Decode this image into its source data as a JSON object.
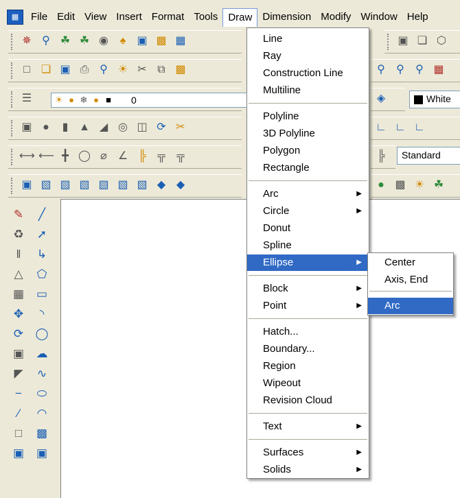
{
  "menubar": {
    "items": [
      "File",
      "Edit",
      "View",
      "Insert",
      "Format",
      "Tools",
      "Draw",
      "Dimension",
      "Modify",
      "Window",
      "Help"
    ],
    "open_item": "Draw"
  },
  "toolbars": {
    "layer_value": "0",
    "color_value": "White",
    "dimstyle_value": "Standard"
  },
  "draw_menu": {
    "groups": [
      [
        {
          "label": "Line"
        },
        {
          "label": "Ray"
        },
        {
          "label": "Construction Line"
        },
        {
          "label": "Multiline"
        }
      ],
      [
        {
          "label": "Polyline"
        },
        {
          "label": "3D Polyline"
        },
        {
          "label": "Polygon"
        },
        {
          "label": "Rectangle"
        }
      ],
      [
        {
          "label": "Arc",
          "submenu": true
        },
        {
          "label": "Circle",
          "submenu": true
        },
        {
          "label": "Donut"
        },
        {
          "label": "Spline"
        },
        {
          "label": "Ellipse",
          "submenu": true,
          "highlighted": true
        }
      ],
      [
        {
          "label": "Block",
          "submenu": true
        },
        {
          "label": "Point",
          "submenu": true
        }
      ],
      [
        {
          "label": "Hatch..."
        },
        {
          "label": "Boundary..."
        },
        {
          "label": "Region"
        },
        {
          "label": "Wipeout"
        },
        {
          "label": "Revision Cloud"
        }
      ],
      [
        {
          "label": "Text",
          "submenu": true
        }
      ],
      [
        {
          "label": "Surfaces",
          "submenu": true
        },
        {
          "label": "Solids",
          "submenu": true
        }
      ]
    ]
  },
  "ellipse_submenu": {
    "items": [
      {
        "label": "Center"
      },
      {
        "label": "Axis, End"
      },
      {
        "label": "Arc",
        "highlighted": true
      }
    ]
  },
  "colors": {
    "highlight": "#316ac5",
    "menu_bg": "#ffffff",
    "chrome": "#ece9d8"
  }
}
